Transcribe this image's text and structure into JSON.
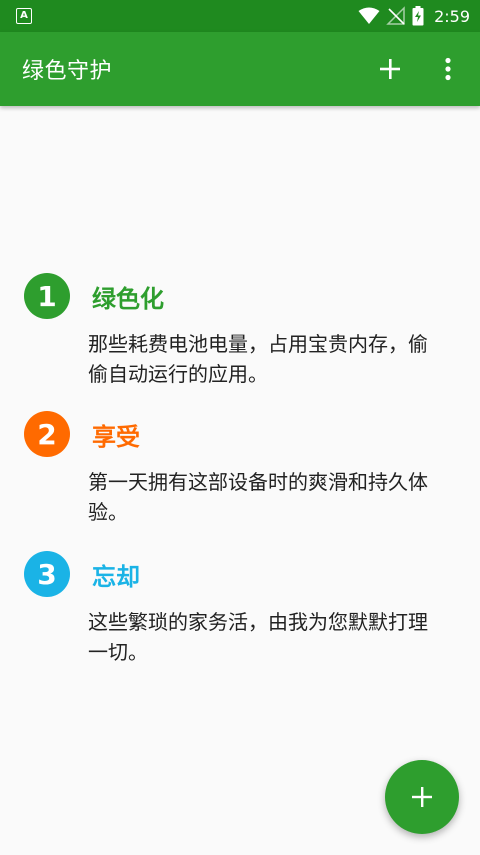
{
  "status_bar": {
    "notification_icon": "A",
    "time": "2:59",
    "icons": [
      "wifi-icon",
      "no-signal-icon",
      "battery-charging-icon"
    ]
  },
  "app_bar": {
    "title": "绿色守护",
    "actions": [
      "add-icon",
      "more-vert-icon"
    ]
  },
  "features": [
    {
      "number": "1",
      "title": "绿色化",
      "description": "那些耗费电池电量，占用宝贵内存，偷偷自动运行的应用。",
      "color": "#2e9e2e"
    },
    {
      "number": "2",
      "title": "享受",
      "description": "第一天拥有这部设备时的爽滑和持久体验。",
      "color": "#ff6a00"
    },
    {
      "number": "3",
      "title": "忘却",
      "description": "这些繁琐的家务活，由我为您默默打理一切。",
      "color": "#1ab3e6"
    }
  ],
  "fab": {
    "icon": "add-icon"
  },
  "colors": {
    "status_bar": "#1f8a1f",
    "app_bar": "#2e9e2e",
    "background": "#fafafa"
  }
}
